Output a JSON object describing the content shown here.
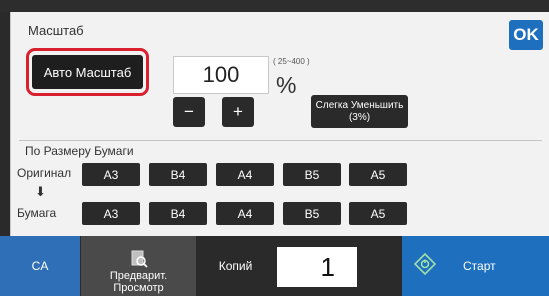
{
  "panel": {
    "title": "Масштаб",
    "ok_label": "OK"
  },
  "scale": {
    "auto_label": "Авто Масштаб",
    "value": "100",
    "range": "( 25~400 )",
    "unit": "%",
    "minus_label": "−",
    "plus_label": "+",
    "reduce_line1": "Слегка Уменьшить",
    "reduce_line2": "(3%)"
  },
  "paper_size": {
    "section_label": "По Размеру Бумаги",
    "original_label": "Оригинал",
    "arrow": "⬇",
    "paper_label": "Бумага",
    "original_sizes": [
      "A3",
      "B4",
      "A4",
      "B5",
      "A5"
    ],
    "paper_sizes": [
      "A3",
      "B4",
      "A4",
      "B5",
      "A5"
    ]
  },
  "bottom_bar": {
    "ca_label": "CA",
    "preview_line1": "Предварит.",
    "preview_line2": "Просмотр",
    "copies_label": "Копий",
    "copies_value": "1",
    "start_label": "Старт"
  },
  "colors": {
    "accent_blue": "#1f6fbf",
    "highlight_red": "#d8202f",
    "button_dark": "#2a2a2a"
  },
  "icons": [
    "preview-icon",
    "start-icon"
  ]
}
